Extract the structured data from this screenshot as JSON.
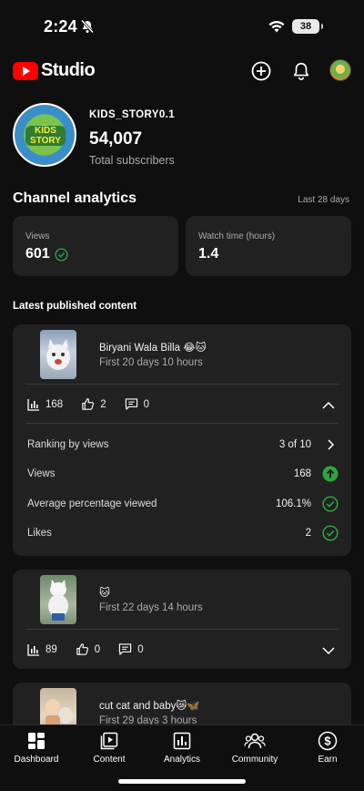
{
  "status_bar": {
    "time": "2:24",
    "battery": "38"
  },
  "header": {
    "logo_text": "Studio",
    "brand_color": "#ff0000"
  },
  "channel": {
    "name": "KIDS_STORY0.1",
    "subscribers": "54,007",
    "subscribers_label": "Total subscribers",
    "avatar_text": "KIDS STORY"
  },
  "analytics": {
    "title": "Channel analytics",
    "range": "Last 28 days",
    "views_label": "Views",
    "views_value": "601",
    "watch_label": "Watch time (hours)",
    "watch_value": "1.4"
  },
  "latest": {
    "title": "Latest published content",
    "videos": [
      {
        "title": "Biryani Wala Billa 😂🐱",
        "published": "First 20 days 10 hours",
        "views": "168",
        "likes": "2",
        "comments": "0",
        "expanded": true,
        "details": [
          {
            "label": "Ranking by views",
            "value": "3 of 10",
            "icon": "chevron-right-icon"
          },
          {
            "label": "Views",
            "value": "168",
            "icon": "arrow-up-circle-icon"
          },
          {
            "label": "Average percentage viewed",
            "value": "106.1%",
            "icon": "check-circle-icon"
          },
          {
            "label": "Likes",
            "value": "2",
            "icon": "check-circle-icon"
          }
        ]
      },
      {
        "title": "🐱",
        "published": "First 22 days 14 hours",
        "views": "89",
        "likes": "0",
        "comments": "0",
        "expanded": false
      },
      {
        "title": "cut cat and baby😿🦋",
        "published": "First 29 days 3 hours",
        "expanded": false
      }
    ]
  },
  "bottom_nav": [
    "Dashboard",
    "Content",
    "Analytics",
    "Community",
    "Earn"
  ],
  "colors": {
    "background": "#0f0f0f",
    "card": "#212121",
    "positive": "#2ba640"
  }
}
